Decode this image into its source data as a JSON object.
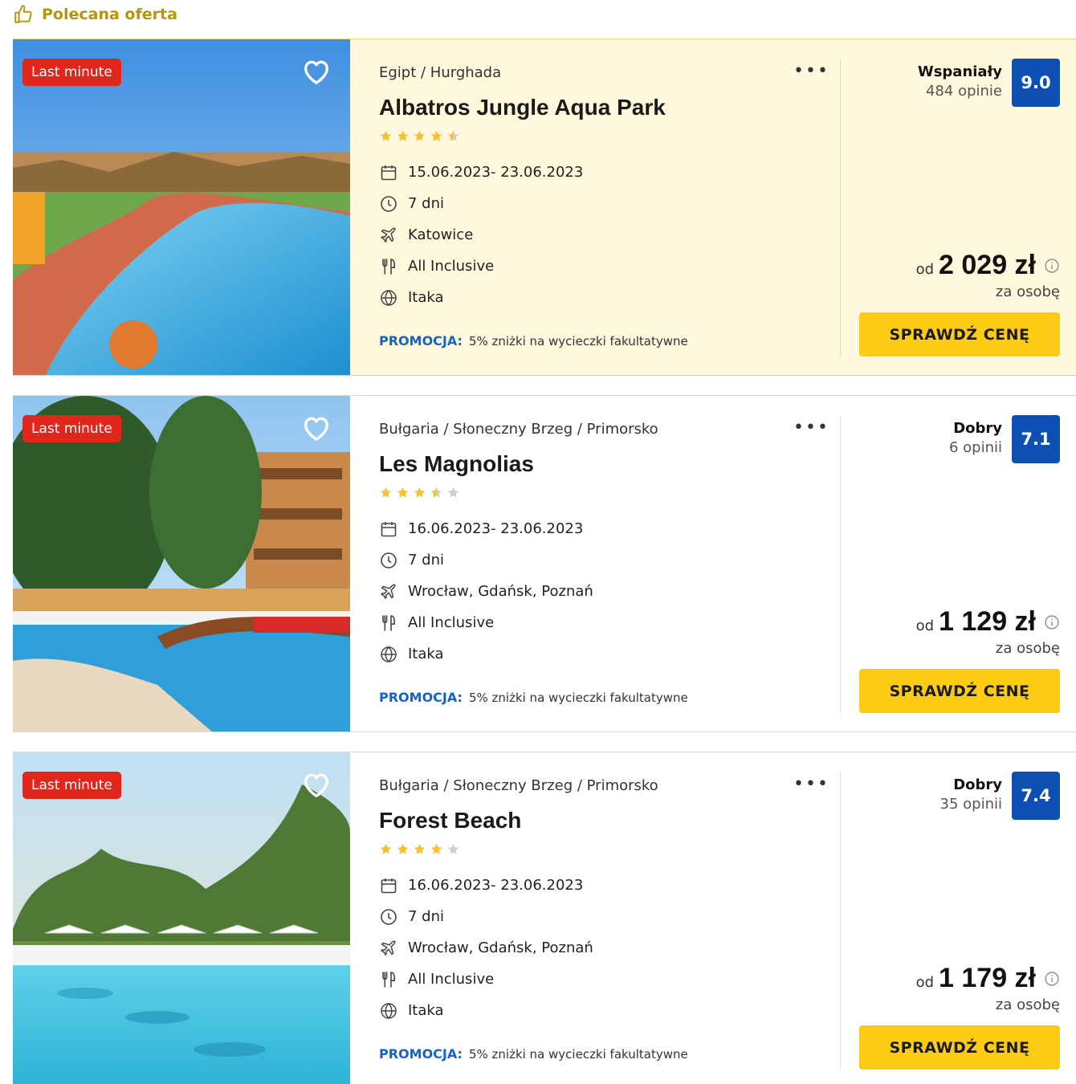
{
  "featured_header": {
    "label": "Polecana oferta",
    "icon": "thumbs-up-icon"
  },
  "offers": [
    {
      "badge": "Last minute",
      "location": "Egipt / Hurghada",
      "name": "Albatros Jungle Aqua Park",
      "stars": 4.5,
      "dates": "15.06.2023- 23.06.2023",
      "duration": "7 dni",
      "departure": "Katowice",
      "board": "All Inclusive",
      "operator": "Itaka",
      "promo_label": "PROMOCJA:",
      "promo_text": "5% zniżki na wycieczki fakultatywne",
      "rating_word": "Wspaniały",
      "reviews": "484 opinie",
      "score": "9.0",
      "price_prefix": "od",
      "price": "2 029 zł",
      "price_note": "za osobę",
      "cta": "SPRAWDŹ CENĘ"
    },
    {
      "badge": "Last minute",
      "location": "Bułgaria / Słoneczny Brzeg / Primorsko",
      "name": "Les Magnolias",
      "stars": 3.5,
      "dates": "16.06.2023- 23.06.2023",
      "duration": "7 dni",
      "departure": "Wrocław, Gdańsk, Poznań",
      "board": "All Inclusive",
      "operator": "Itaka",
      "promo_label": "PROMOCJA:",
      "promo_text": "5% zniżki na wycieczki fakultatywne",
      "rating_word": "Dobry",
      "reviews": "6 opinii",
      "score": "7.1",
      "price_prefix": "od",
      "price": "1 129 zł",
      "price_note": "za osobę",
      "cta": "SPRAWDŹ CENĘ"
    },
    {
      "badge": "Last minute",
      "location": "Bułgaria / Słoneczny Brzeg / Primorsko",
      "name": "Forest Beach",
      "stars": 4,
      "dates": "16.06.2023- 23.06.2023",
      "duration": "7 dni",
      "departure": "Wrocław, Gdańsk, Poznań",
      "board": "All Inclusive",
      "operator": "Itaka",
      "promo_label": "PROMOCJA:",
      "promo_text": "5% zniżki na wycieczki fakultatywne",
      "rating_word": "Dobry",
      "reviews": "35 opinii",
      "score": "7.4",
      "price_prefix": "od",
      "price": "1 179 zł",
      "price_note": "za osobę",
      "cta": "SPRAWDŹ CENĘ"
    }
  ],
  "colors": {
    "accent_yellow": "#fccc14",
    "badge_red": "#e1261c",
    "score_blue": "#0d4fb3",
    "promo_blue": "#1464c8",
    "featured_bg": "#fff8dc",
    "header_gold": "#b7940c",
    "star": "#fbc02d",
    "star_empty": "#cfcfcf"
  },
  "icons": {
    "dates": "calendar-icon",
    "duration": "clock-icon",
    "departure": "plane-icon",
    "board": "cutlery-icon",
    "operator": "globe-icon",
    "favorite": "heart-icon",
    "more": "more-dots-icon",
    "price_info": "info-icon"
  }
}
